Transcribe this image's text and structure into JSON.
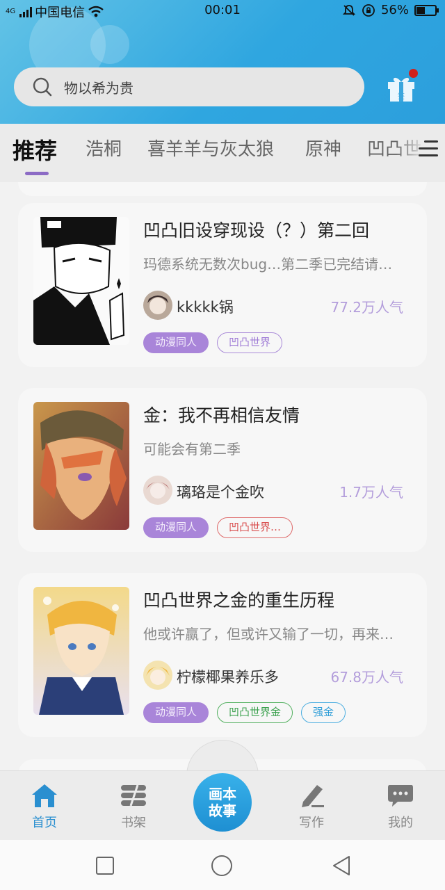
{
  "status_bar": {
    "carrier": "中国电信",
    "network": "4G",
    "time": "00:01",
    "battery": "56%"
  },
  "search": {
    "placeholder": "物以希为贵"
  },
  "tabs": [
    {
      "label": "推荐",
      "active": true
    },
    {
      "label": "浩桐"
    },
    {
      "label": "喜羊羊与灰太狼"
    },
    {
      "label": "原神"
    },
    {
      "label": "凹凸世"
    }
  ],
  "stories": [
    {
      "title": "凹凸旧设穿现设（？）第二回",
      "description": "玛德系统无数次bug…第二季已完结请…",
      "author": "kkkkk锅",
      "popularity": "77.2万人气",
      "tags": [
        {
          "label": "动漫同人",
          "style": "fill"
        },
        {
          "label": "凹凸世界",
          "style": "purple"
        }
      ]
    },
    {
      "title": "金：我不再相信友情",
      "description": "可能会有第二季",
      "author": "璃珞是个金吹",
      "popularity": "1.7万人气",
      "tags": [
        {
          "label": "动漫同人",
          "style": "fill"
        },
        {
          "label": "凹凸世界…",
          "style": "red"
        }
      ]
    },
    {
      "title": "凹凸世界之金的重生历程",
      "description": "他或许赢了，但或许又输了一切，再来…",
      "author": "柠檬椰果养乐多",
      "popularity": "67.8万人气",
      "tags": [
        {
          "label": "动漫同人",
          "style": "fill"
        },
        {
          "label": "凹凸世界金",
          "style": "green"
        },
        {
          "label": "强金",
          "style": "blue"
        }
      ]
    }
  ],
  "bottom_nav": {
    "home": "首页",
    "bookshelf": "书架",
    "center_line1": "画本",
    "center_line2": "故事",
    "write": "写作",
    "mine": "我的"
  },
  "colors": {
    "accent": "#2a8fd0",
    "tab_underline": "#8c6bc5",
    "popularity": "#b39ddb"
  }
}
